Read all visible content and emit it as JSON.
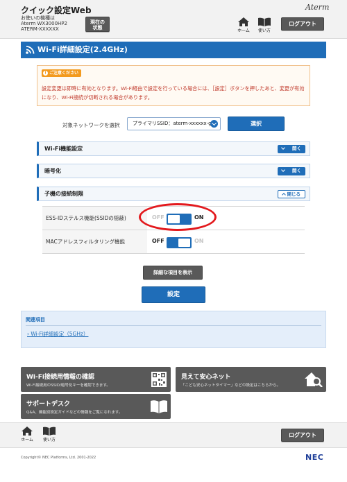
{
  "header": {
    "app_title": "クイック設定Web",
    "device_label": "お使いの機種は",
    "model": "Aterm WX3000HP2",
    "device_name": "ATERM-XXXXXX",
    "status_button": "現在の\n状態",
    "brand": "Aterm",
    "home_label": "ホーム",
    "help_label": "使い方",
    "logout_label": "ログアウト"
  },
  "page_title": "Wi-Fi詳細設定(2.4GHz)",
  "notice": {
    "badge": "ご注意ください",
    "message": "設定変更は即時に有効となります。Wi-Fi経由で設定を行っている場合には、［設定］ボタンを押したあと、変更が有効になり、Wi-Fi接続が切断される場合があります。"
  },
  "network": {
    "label": "対象ネットワークを選択",
    "selected": "プライマリSSID：aterm-xxxxxx-g",
    "select_button": "選択"
  },
  "sections": [
    {
      "label": "Wi-Fi機能設定",
      "toggle": "開く"
    },
    {
      "label": "暗号化",
      "toggle": "開く"
    },
    {
      "label": "子機の接続制限",
      "toggle": "閉じる"
    }
  ],
  "settings": [
    {
      "label": "ESS-IDステルス機能(SSIDの隠蔽)",
      "state": "ON",
      "off_text": "OFF",
      "on_text": "ON"
    },
    {
      "label": "MACアドレスフィルタリング機能",
      "state": "OFF",
      "off_text": "OFF",
      "on_text": "ON"
    }
  ],
  "detail_button": "詳細な項目を表示",
  "set_button": "設定",
  "related": {
    "heading": "関連項目",
    "link": "Wi-Fi詳細設定（5GHz）"
  },
  "tiles": {
    "wifi_info_title": "Wi-Fi接続用情報の確認",
    "wifi_info_desc": "Wi-Fi接続用のSSID/暗号化キーを確認できます。",
    "safety_title": "見えて安心ネット",
    "safety_desc": "「こども安心ネットタイマー」などの設定はこちらから。",
    "support_title": "サポートデスク",
    "support_desc": "Q&A、機能別設定ガイドなどの情報をご覧になれます。"
  },
  "footer": {
    "home_label": "ホーム",
    "help_label": "使い方",
    "logout_label": "ログアウト",
    "copyright": "Copyright© NEC Platforms, Ltd. 2001-2022",
    "nec_logo": "NEC"
  },
  "colors": {
    "primary_blue": "#1f6db8",
    "dark_button": "#595959",
    "notice_text": "#c0392b",
    "highlight_ring": "#e3191d"
  }
}
